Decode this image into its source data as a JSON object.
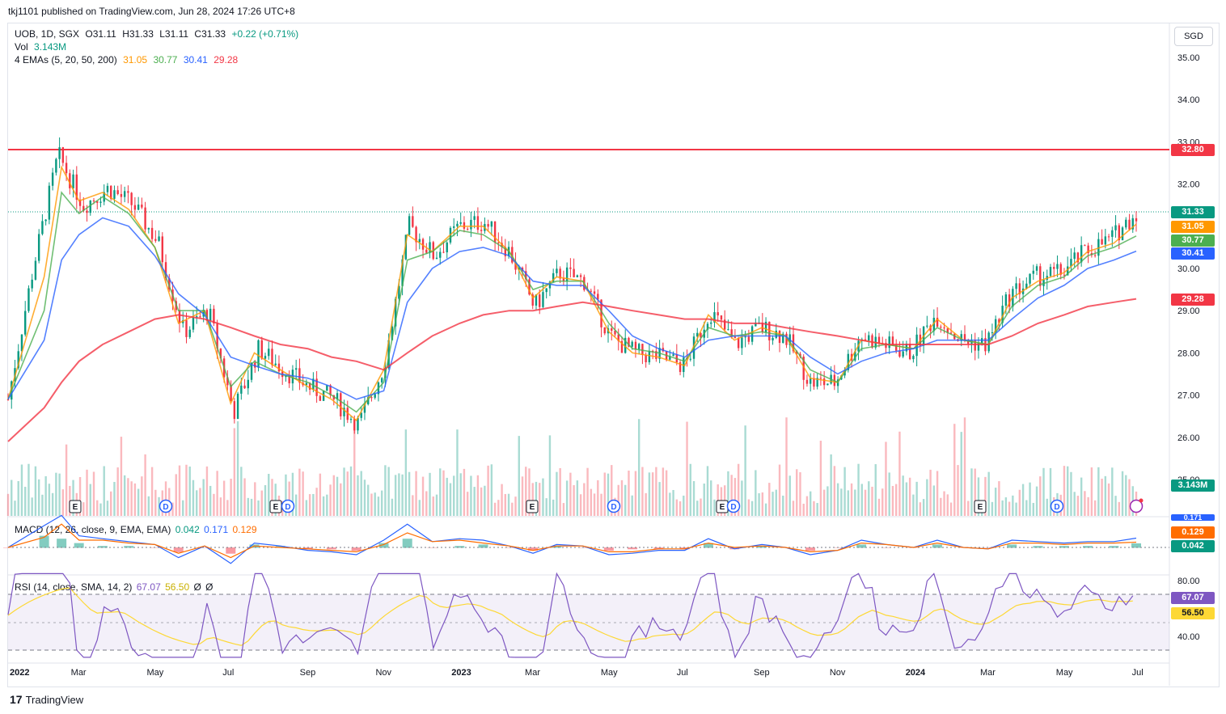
{
  "header": {
    "published": "tkj1101 published on TradingView.com, Jun 28, 2024 17:26 UTC+8"
  },
  "legend": {
    "symbol": "UOB, 1D, SGX",
    "o": "O31.11",
    "h": "H31.33",
    "l": "L31.11",
    "c": "C31.33",
    "change": "+0.22 (+0.71%)",
    "vol_label": "Vol",
    "vol_value": "3.143M",
    "ema_label": "4 EMAs (5, 20, 50, 200)",
    "ema5": "31.05",
    "ema20": "30.77",
    "ema50": "30.41",
    "ema200": "29.28"
  },
  "currency": "SGD",
  "macd_legend": {
    "label": "MACD (12, 26, close, 9, EMA, EMA)",
    "hist": "0.042",
    "macd": "0.171",
    "signal": "0.129"
  },
  "rsi_legend": {
    "label": "RSI (14, close, SMA, 14, 2)",
    "rsi": "67.07",
    "sma": "56.50",
    "extra1": "Ø",
    "extra2": "Ø"
  },
  "price_tags": {
    "resistance": "32.80",
    "last": "31.33",
    "ema5": "31.05",
    "ema20": "30.77",
    "ema50": "30.41",
    "ema200": "29.28",
    "volume": "3.143M",
    "macd": "0.171",
    "signal": "0.129",
    "hist": "0.042",
    "rsi": "67.07",
    "rsi_sma": "56.50"
  },
  "colors": {
    "up": "#089981",
    "down": "#f23645",
    "ema5": "#ff9800",
    "ema20": "#4caf50",
    "ema50": "#2962ff",
    "ema200": "#f23645",
    "resistance": "#f23645",
    "rsi": "#7e57c2",
    "rsi_sma": "#fdd835",
    "macd": "#2962ff",
    "signal": "#ff6d00"
  },
  "events": [
    {
      "type": "E",
      "date": "2022-02"
    },
    {
      "type": "D",
      "date": "2022-04"
    },
    {
      "type": "E",
      "date": "2022-08"
    },
    {
      "type": "D",
      "date": "2022-08"
    },
    {
      "type": "E",
      "date": "2023-02"
    },
    {
      "type": "D",
      "date": "2023-04"
    },
    {
      "type": "E",
      "date": "2023-08"
    },
    {
      "type": "D",
      "date": "2023-08"
    },
    {
      "type": "E",
      "date": "2024-02"
    },
    {
      "type": "D",
      "date": "2024-04"
    }
  ],
  "logo": "TradingView",
  "chart_data": {
    "type": "line",
    "price_axis": [
      "35.00",
      "34.00",
      "33.00",
      "32.00",
      "30.00",
      "29.00",
      "28.00",
      "27.00",
      "26.00",
      "25.00"
    ],
    "time_axis": [
      "2022",
      "Mar",
      "May",
      "Jul",
      "Sep",
      "Nov",
      "2023",
      "Mar",
      "May",
      "Jul",
      "Sep",
      "Nov",
      "2024",
      "Mar",
      "May",
      "Jul"
    ],
    "rsi_axis": [
      "80.00",
      "40.00"
    ],
    "resistance_level": 32.8,
    "ylim": [
      25,
      35.3
    ],
    "x": [
      "2022-01-03",
      "2022-02-01",
      "2022-02-15",
      "2022-03-01",
      "2022-03-20",
      "2022-04-10",
      "2022-05-01",
      "2022-05-20",
      "2022-06-10",
      "2022-07-01",
      "2022-07-20",
      "2022-08-10",
      "2022-09-01",
      "2022-09-20",
      "2022-10-10",
      "2022-11-01",
      "2022-11-20",
      "2022-12-10",
      "2023-01-01",
      "2023-01-20",
      "2023-02-10",
      "2023-03-01",
      "2023-03-20",
      "2023-04-10",
      "2023-05-01",
      "2023-05-20",
      "2023-06-10",
      "2023-07-01",
      "2023-07-20",
      "2023-08-10",
      "2023-09-01",
      "2023-09-20",
      "2023-10-10",
      "2023-11-01",
      "2023-11-20",
      "2023-12-10",
      "2024-01-01",
      "2024-01-20",
      "2024-02-10",
      "2024-03-01",
      "2024-03-20",
      "2024-04-10",
      "2024-05-01",
      "2024-05-20",
      "2024-06-10",
      "2024-06-28"
    ],
    "series": [
      {
        "name": "UOB",
        "values": [
          26.9,
          30.0,
          32.7,
          31.5,
          31.9,
          31.5,
          30.6,
          28.5,
          29.0,
          26.6,
          28.1,
          27.6,
          27.2,
          26.9,
          26.3,
          27.7,
          31.0,
          30.3,
          31.0,
          31.1,
          30.4,
          29.1,
          29.9,
          29.7,
          28.4,
          28.0,
          27.9,
          27.7,
          29.0,
          28.2,
          28.6,
          28.4,
          27.3,
          27.3,
          28.4,
          28.2,
          28.0,
          28.9,
          28.3,
          28.2,
          29.4,
          29.8,
          29.9,
          30.4,
          30.7,
          31.33
        ]
      },
      {
        "name": "EMA 5",
        "values": [
          26.9,
          29.8,
          32.4,
          31.6,
          31.8,
          31.4,
          30.5,
          28.7,
          29.0,
          26.8,
          28.0,
          27.6,
          27.2,
          26.9,
          26.4,
          27.6,
          30.8,
          30.4,
          31.0,
          31.0,
          30.4,
          29.3,
          29.8,
          29.7,
          28.5,
          28.0,
          27.9,
          27.7,
          28.9,
          28.3,
          28.6,
          28.4,
          27.4,
          27.3,
          28.3,
          28.2,
          28.1,
          28.8,
          28.3,
          28.2,
          29.3,
          29.7,
          29.9,
          30.4,
          30.6,
          31.05
        ]
      },
      {
        "name": "EMA 20",
        "values": [
          26.9,
          29.0,
          31.8,
          31.3,
          31.7,
          31.3,
          30.5,
          29.0,
          29.0,
          27.2,
          27.8,
          27.5,
          27.3,
          27.0,
          26.6,
          27.3,
          30.2,
          30.4,
          30.9,
          30.8,
          30.4,
          29.5,
          29.7,
          29.7,
          28.7,
          28.1,
          28.0,
          27.8,
          28.6,
          28.4,
          28.5,
          28.4,
          27.6,
          27.3,
          28.1,
          28.2,
          28.1,
          28.6,
          28.3,
          28.2,
          29.1,
          29.6,
          29.8,
          30.3,
          30.5,
          30.77
        ]
      },
      {
        "name": "EMA 50",
        "values": [
          26.9,
          28.3,
          30.2,
          30.8,
          31.2,
          31.0,
          30.3,
          29.4,
          28.9,
          27.9,
          27.7,
          27.5,
          27.4,
          27.2,
          26.9,
          27.1,
          29.2,
          30.0,
          30.4,
          30.5,
          30.3,
          29.7,
          29.6,
          29.6,
          29.0,
          28.4,
          28.1,
          27.9,
          28.3,
          28.4,
          28.4,
          28.4,
          27.9,
          27.5,
          27.8,
          28.0,
          28.1,
          28.3,
          28.3,
          28.3,
          28.8,
          29.3,
          29.6,
          30.0,
          30.2,
          30.41
        ]
      },
      {
        "name": "EMA 200",
        "values": [
          25.9,
          26.7,
          27.3,
          27.8,
          28.2,
          28.5,
          28.8,
          28.9,
          28.8,
          28.6,
          28.4,
          28.2,
          28.1,
          27.9,
          27.8,
          27.6,
          28.0,
          28.4,
          28.7,
          28.9,
          29.0,
          29.0,
          29.1,
          29.2,
          29.1,
          29.0,
          28.9,
          28.8,
          28.8,
          28.7,
          28.7,
          28.6,
          28.5,
          28.4,
          28.3,
          28.2,
          28.2,
          28.2,
          28.2,
          28.2,
          28.4,
          28.7,
          28.9,
          29.1,
          29.2,
          29.28
        ]
      }
    ]
  }
}
